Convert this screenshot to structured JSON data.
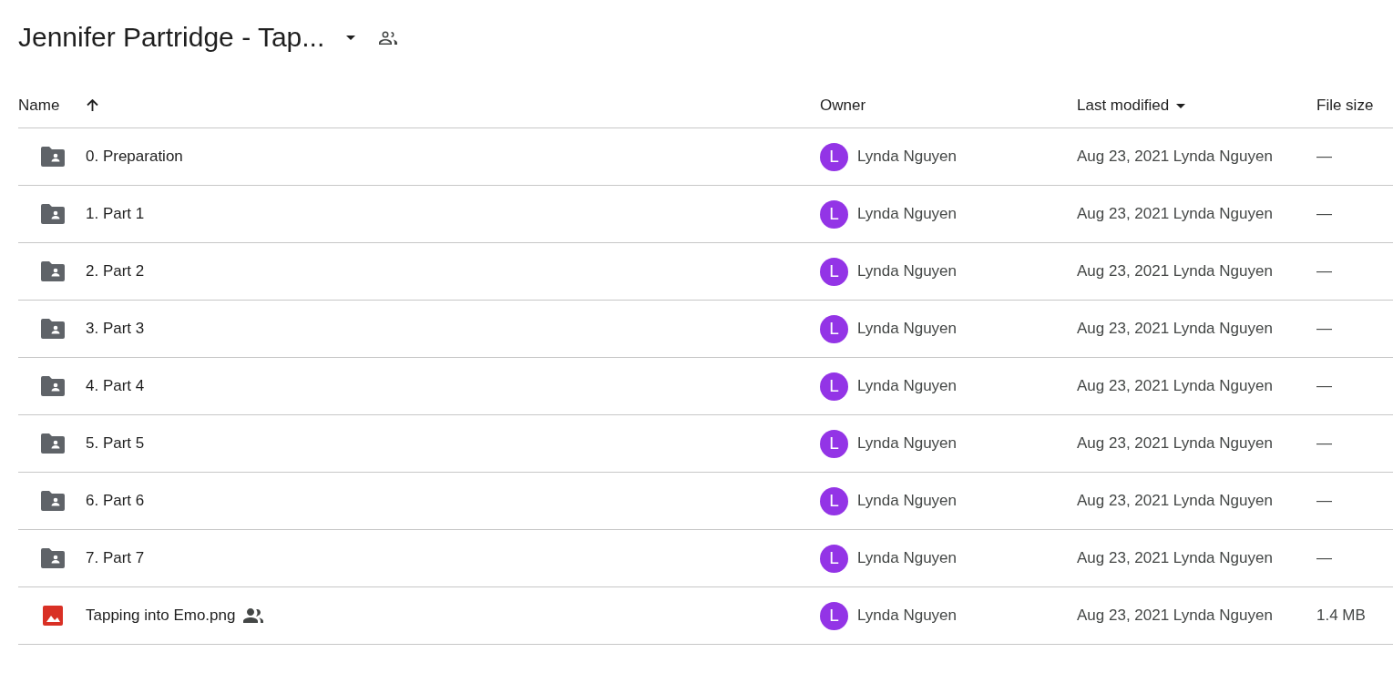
{
  "header": {
    "title": "Jennifer Partridge - Tap..."
  },
  "table": {
    "columns": [
      {
        "label": "Name",
        "sorted": true,
        "menu": false
      },
      {
        "label": "Owner",
        "sorted": false,
        "menu": false
      },
      {
        "label": "Last modified",
        "sorted": false,
        "menu": true
      },
      {
        "label": "File size",
        "sorted": false,
        "menu": false
      }
    ],
    "rows": [
      {
        "kind": "shared-folder",
        "name": "0. Preparation",
        "shared": false,
        "owner_initial": "L",
        "owner": "Lynda Nguyen",
        "modified": "Aug 23, 2021 Lynda Nguyen",
        "size": "—"
      },
      {
        "kind": "shared-folder",
        "name": "1. Part 1",
        "shared": false,
        "owner_initial": "L",
        "owner": "Lynda Nguyen",
        "modified": "Aug 23, 2021 Lynda Nguyen",
        "size": "—"
      },
      {
        "kind": "shared-folder",
        "name": "2. Part 2",
        "shared": false,
        "owner_initial": "L",
        "owner": "Lynda Nguyen",
        "modified": "Aug 23, 2021 Lynda Nguyen",
        "size": "—"
      },
      {
        "kind": "shared-folder",
        "name": "3. Part 3",
        "shared": false,
        "owner_initial": "L",
        "owner": "Lynda Nguyen",
        "modified": "Aug 23, 2021 Lynda Nguyen",
        "size": "—"
      },
      {
        "kind": "shared-folder",
        "name": "4. Part 4",
        "shared": false,
        "owner_initial": "L",
        "owner": "Lynda Nguyen",
        "modified": "Aug 23, 2021 Lynda Nguyen",
        "size": "—"
      },
      {
        "kind": "shared-folder",
        "name": "5. Part 5",
        "shared": false,
        "owner_initial": "L",
        "owner": "Lynda Nguyen",
        "modified": "Aug 23, 2021 Lynda Nguyen",
        "size": "—"
      },
      {
        "kind": "shared-folder",
        "name": "6. Part 6",
        "shared": false,
        "owner_initial": "L",
        "owner": "Lynda Nguyen",
        "modified": "Aug 23, 2021 Lynda Nguyen",
        "size": "—"
      },
      {
        "kind": "shared-folder",
        "name": "7. Part 7",
        "shared": false,
        "owner_initial": "L",
        "owner": "Lynda Nguyen",
        "modified": "Aug 23, 2021 Lynda Nguyen",
        "size": "—"
      },
      {
        "kind": "image",
        "name": "Tapping into Emo.png",
        "shared": true,
        "owner_initial": "L",
        "owner": "Lynda Nguyen",
        "modified": "Aug 23, 2021 Lynda Nguyen",
        "size": "1.4 MB"
      }
    ]
  }
}
